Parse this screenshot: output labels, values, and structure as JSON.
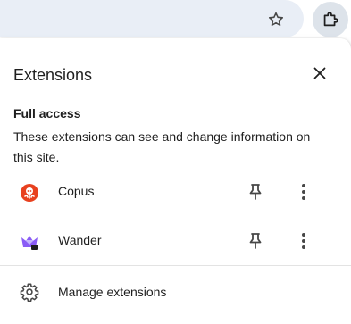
{
  "toolbar": {
    "star_icon": "star-outline-icon",
    "extensions_icon": "puzzle-icon"
  },
  "panel": {
    "title": "Extensions",
    "close_icon": "close-icon",
    "section": {
      "title": "Full access",
      "description": "These extensions can see and change information on this site."
    },
    "extensions": [
      {
        "name": "Copus",
        "icon": "copus-octopus-icon",
        "icon_color": "#e8411f"
      },
      {
        "name": "Wander",
        "icon": "wander-crown-icon",
        "icon_color": "#8a5cf6"
      }
    ],
    "manage_label": "Manage extensions"
  },
  "colors": {
    "omnibox_bg": "#e9eef6",
    "active_button_bg": "#dde3ea",
    "text": "#1f1f1f",
    "icon": "#474747"
  }
}
